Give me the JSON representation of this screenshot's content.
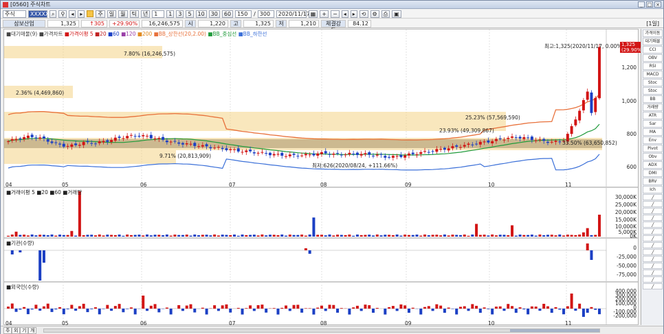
{
  "window": {
    "title": "[0560] 주식차트"
  },
  "toolbar1": {
    "market": "주식",
    "code": "XXXXXX",
    "tab_labels": [
      "주",
      "일",
      "월",
      "틱",
      "분"
    ],
    "period_btn": "년",
    "count_input": "1",
    "interval_buttons": [
      "1",
      "3",
      "5",
      "10",
      "30",
      "60"
    ],
    "num_input": "150",
    "slash": "/",
    "total": "300",
    "date": "2020/11/17"
  },
  "toolbar2": {
    "stock_name": "삼보산업",
    "price": "1,325",
    "change": "↑305",
    "change_pct": "+29.90%",
    "volume": "16,246,575",
    "open_label": "시",
    "open": "1,220",
    "high_label": "고",
    "high": "1,325",
    "low_label": "저",
    "low": "1,210",
    "strength_label": "체결강도",
    "strength": "84.12",
    "period_label": "[1일]"
  },
  "chart": {
    "price_legend": [
      "■대기매물(9)",
      "■가격차트",
      "■가격이평 5",
      "■20",
      "■60",
      "■120",
      "■200",
      "■BB_상한선(20,2.00)",
      "■BB_중심선",
      "■BB_하한선"
    ],
    "price_axis": [
      "1,200",
      "1,000",
      "800",
      "600"
    ],
    "price_tag": "1,325",
    "price_tag_pct": "(29.90%)",
    "annotations": {
      "high": "최고:1,325(2020/11/17, 0.00%)",
      "low": "최저:626(2020/08/24, +111.66%)",
      "box1": "7.80% (16,246,575)",
      "box2": "2.36% (4,469,860)",
      "box3": "25.23% (57,569,590)",
      "box4": "23.93% (49,309,867)",
      "box5": "9.71% (20,813,909)",
      "box6": "33.50% (63,650,852)"
    },
    "months": [
      "04",
      "05",
      "06",
      "07",
      "08",
      "09",
      "10",
      "11"
    ],
    "volume_legend": "■거래이평 5 ■20 ■60 ■거래량",
    "volume_axis": [
      "30,000K",
      "25,000K",
      "20,000K",
      "15,000K",
      "10,000K",
      "5,000K",
      "0K"
    ],
    "inst_legend": "■기관(수량)",
    "inst_axis": [
      "0",
      "-25,000",
      "-50,000",
      "-75,000"
    ],
    "foreign_legend": "■외국인(수량)",
    "foreign_axis": [
      "400,000",
      "300,000",
      "200,000",
      "100,000",
      "0",
      "-100,000",
      "-200,000"
    ]
  },
  "rightbar": {
    "items": [
      "가격이동",
      "대기매물",
      "CCI",
      "OBV",
      "RSI",
      "MACD",
      "Stoc",
      "Stoc",
      "BB",
      "거래량",
      "ATR",
      "Sar",
      "MA",
      "Env",
      "Pivot",
      "Obv",
      "ADX",
      "DMI",
      "BRV",
      "Ich"
    ]
  },
  "bottombar": {
    "tabs": [
      "주",
      "외",
      "기",
      "개"
    ]
  },
  "colors": {
    "up": "#d21515",
    "down": "#1b3fc4",
    "bb_upper": "#e8703a",
    "bb_mid": "#1f9a3a",
    "bb_lower": "#3a6fd8",
    "box": "#f4d487"
  },
  "chart_data": {
    "type": "candlestick",
    "months": [
      "04",
      "05",
      "06",
      "07",
      "08",
      "09",
      "10",
      "11"
    ],
    "price_range": [
      520,
      1360
    ],
    "last": {
      "date": "2020/11/17",
      "open": 1220,
      "high": 1325,
      "low": 1210,
      "close": 1325
    }
  }
}
